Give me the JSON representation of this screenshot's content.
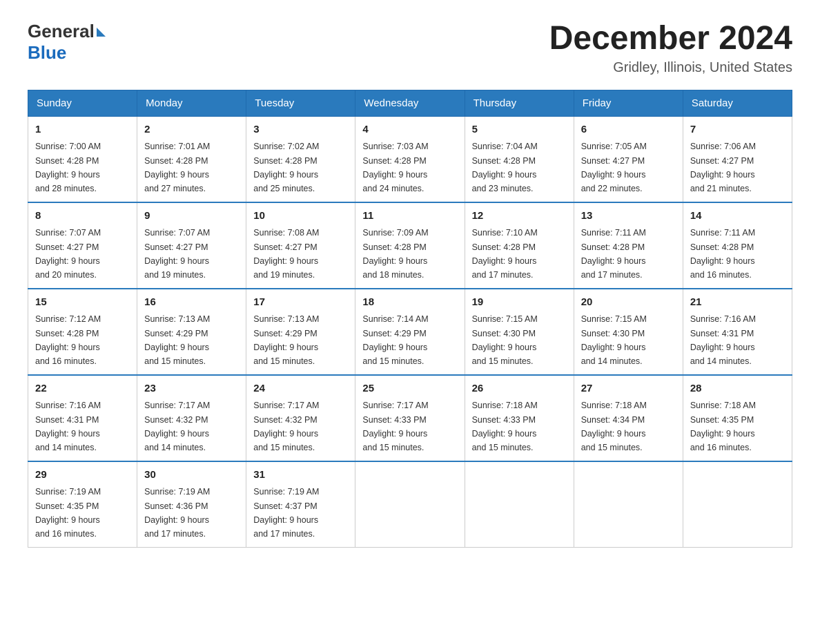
{
  "header": {
    "logo_general": "General",
    "logo_blue": "Blue",
    "month_title": "December 2024",
    "location": "Gridley, Illinois, United States"
  },
  "weekdays": [
    "Sunday",
    "Monday",
    "Tuesday",
    "Wednesday",
    "Thursday",
    "Friday",
    "Saturday"
  ],
  "weeks": [
    [
      {
        "day": "1",
        "sunrise": "7:00 AM",
        "sunset": "4:28 PM",
        "daylight": "9 hours and 28 minutes."
      },
      {
        "day": "2",
        "sunrise": "7:01 AM",
        "sunset": "4:28 PM",
        "daylight": "9 hours and 27 minutes."
      },
      {
        "day": "3",
        "sunrise": "7:02 AM",
        "sunset": "4:28 PM",
        "daylight": "9 hours and 25 minutes."
      },
      {
        "day": "4",
        "sunrise": "7:03 AM",
        "sunset": "4:28 PM",
        "daylight": "9 hours and 24 minutes."
      },
      {
        "day": "5",
        "sunrise": "7:04 AM",
        "sunset": "4:28 PM",
        "daylight": "9 hours and 23 minutes."
      },
      {
        "day": "6",
        "sunrise": "7:05 AM",
        "sunset": "4:27 PM",
        "daylight": "9 hours and 22 minutes."
      },
      {
        "day": "7",
        "sunrise": "7:06 AM",
        "sunset": "4:27 PM",
        "daylight": "9 hours and 21 minutes."
      }
    ],
    [
      {
        "day": "8",
        "sunrise": "7:07 AM",
        "sunset": "4:27 PM",
        "daylight": "9 hours and 20 minutes."
      },
      {
        "day": "9",
        "sunrise": "7:07 AM",
        "sunset": "4:27 PM",
        "daylight": "9 hours and 19 minutes."
      },
      {
        "day": "10",
        "sunrise": "7:08 AM",
        "sunset": "4:27 PM",
        "daylight": "9 hours and 19 minutes."
      },
      {
        "day": "11",
        "sunrise": "7:09 AM",
        "sunset": "4:28 PM",
        "daylight": "9 hours and 18 minutes."
      },
      {
        "day": "12",
        "sunrise": "7:10 AM",
        "sunset": "4:28 PM",
        "daylight": "9 hours and 17 minutes."
      },
      {
        "day": "13",
        "sunrise": "7:11 AM",
        "sunset": "4:28 PM",
        "daylight": "9 hours and 17 minutes."
      },
      {
        "day": "14",
        "sunrise": "7:11 AM",
        "sunset": "4:28 PM",
        "daylight": "9 hours and 16 minutes."
      }
    ],
    [
      {
        "day": "15",
        "sunrise": "7:12 AM",
        "sunset": "4:28 PM",
        "daylight": "9 hours and 16 minutes."
      },
      {
        "day": "16",
        "sunrise": "7:13 AM",
        "sunset": "4:29 PM",
        "daylight": "9 hours and 15 minutes."
      },
      {
        "day": "17",
        "sunrise": "7:13 AM",
        "sunset": "4:29 PM",
        "daylight": "9 hours and 15 minutes."
      },
      {
        "day": "18",
        "sunrise": "7:14 AM",
        "sunset": "4:29 PM",
        "daylight": "9 hours and 15 minutes."
      },
      {
        "day": "19",
        "sunrise": "7:15 AM",
        "sunset": "4:30 PM",
        "daylight": "9 hours and 15 minutes."
      },
      {
        "day": "20",
        "sunrise": "7:15 AM",
        "sunset": "4:30 PM",
        "daylight": "9 hours and 14 minutes."
      },
      {
        "day": "21",
        "sunrise": "7:16 AM",
        "sunset": "4:31 PM",
        "daylight": "9 hours and 14 minutes."
      }
    ],
    [
      {
        "day": "22",
        "sunrise": "7:16 AM",
        "sunset": "4:31 PM",
        "daylight": "9 hours and 14 minutes."
      },
      {
        "day": "23",
        "sunrise": "7:17 AM",
        "sunset": "4:32 PM",
        "daylight": "9 hours and 14 minutes."
      },
      {
        "day": "24",
        "sunrise": "7:17 AM",
        "sunset": "4:32 PM",
        "daylight": "9 hours and 15 minutes."
      },
      {
        "day": "25",
        "sunrise": "7:17 AM",
        "sunset": "4:33 PM",
        "daylight": "9 hours and 15 minutes."
      },
      {
        "day": "26",
        "sunrise": "7:18 AM",
        "sunset": "4:33 PM",
        "daylight": "9 hours and 15 minutes."
      },
      {
        "day": "27",
        "sunrise": "7:18 AM",
        "sunset": "4:34 PM",
        "daylight": "9 hours and 15 minutes."
      },
      {
        "day": "28",
        "sunrise": "7:18 AM",
        "sunset": "4:35 PM",
        "daylight": "9 hours and 16 minutes."
      }
    ],
    [
      {
        "day": "29",
        "sunrise": "7:19 AM",
        "sunset": "4:35 PM",
        "daylight": "9 hours and 16 minutes."
      },
      {
        "day": "30",
        "sunrise": "7:19 AM",
        "sunset": "4:36 PM",
        "daylight": "9 hours and 17 minutes."
      },
      {
        "day": "31",
        "sunrise": "7:19 AM",
        "sunset": "4:37 PM",
        "daylight": "9 hours and 17 minutes."
      },
      null,
      null,
      null,
      null
    ]
  ]
}
